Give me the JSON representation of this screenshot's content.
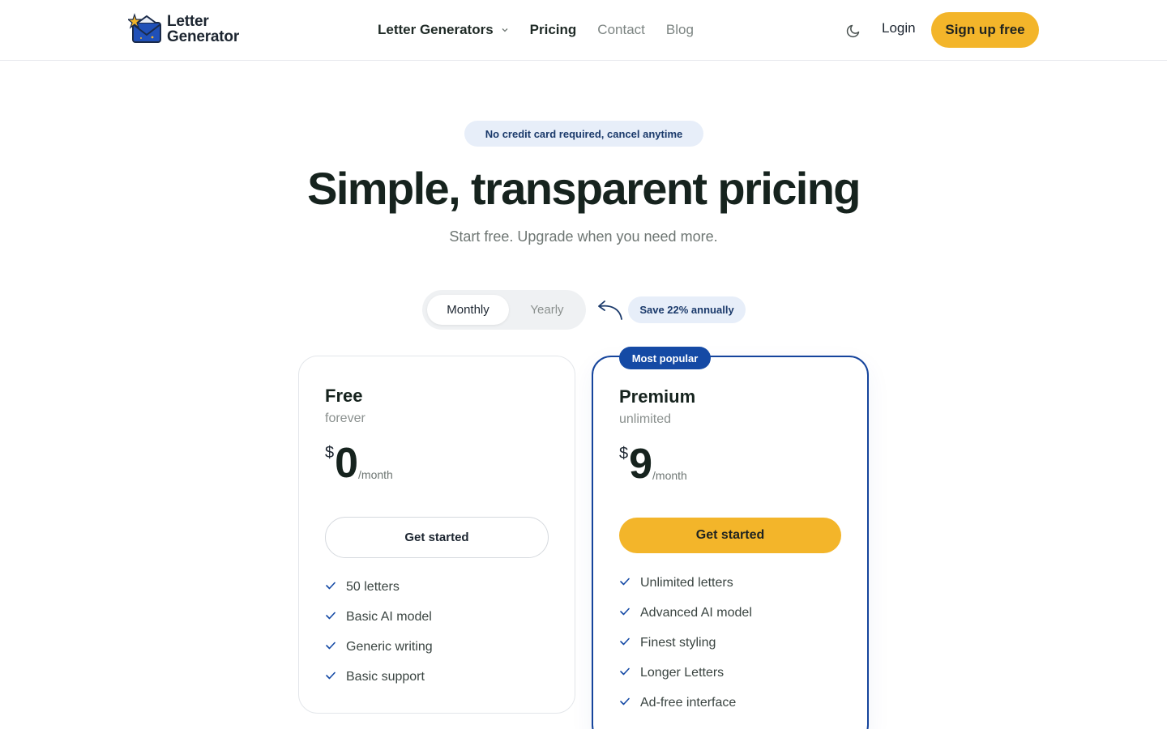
{
  "brand": {
    "line1": "Letter",
    "line2": "Generator",
    "colors": {
      "navy": "#1b3a6b",
      "blue": "#154aa5",
      "yellow": "#f3b52a"
    }
  },
  "nav": {
    "links": [
      {
        "label": "Letter Generators",
        "has_dropdown": true
      },
      {
        "label": "Pricing"
      },
      {
        "label": "Contact"
      },
      {
        "label": "Blog"
      }
    ],
    "theme_icon": "moon-icon",
    "login": "Login",
    "signup": "Sign up free"
  },
  "hero": {
    "badge": "No credit card required, cancel anytime",
    "title": "Simple, transparent pricing",
    "subtitle": "Start free. Upgrade when you need more."
  },
  "billing": {
    "options": [
      "Monthly",
      "Yearly"
    ],
    "selected": "Monthly",
    "save_badge": "Save 22% annually"
  },
  "plans": [
    {
      "name": "Free",
      "period": "forever",
      "currency": "$",
      "price": "0",
      "per": "/month",
      "cta": "Get started",
      "features": [
        "50 letters",
        "Basic AI model",
        "Generic writing",
        "Basic support"
      ]
    },
    {
      "name": "Premium",
      "badge": "Most popular",
      "period": "unlimited",
      "currency": "$",
      "price": "9",
      "per": "/month",
      "cta": "Get started",
      "features": [
        "Unlimited letters",
        "Advanced AI model",
        "Finest styling",
        "Longer Letters",
        "Ad-free interface"
      ]
    }
  ]
}
